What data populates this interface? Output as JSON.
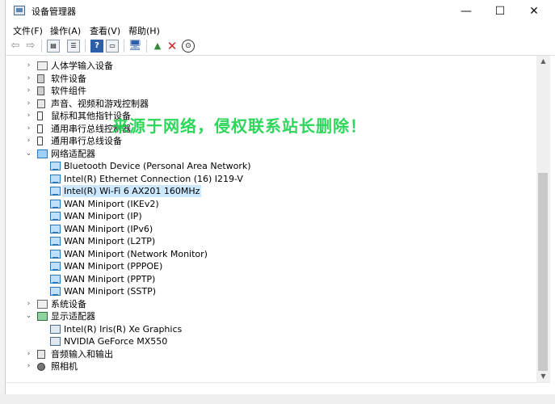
{
  "window": {
    "title": "设备管理器",
    "controls": {
      "minimize": "—",
      "maximize": "☐",
      "close": "✕"
    }
  },
  "menu": {
    "items": [
      {
        "label": "文件(F)"
      },
      {
        "label": "操作(A)"
      },
      {
        "label": "查看(V)"
      },
      {
        "label": "帮助(H)"
      }
    ]
  },
  "toolbar": {
    "buttons": [
      {
        "name": "back-arrow-icon",
        "glyph": "⇦"
      },
      {
        "name": "forward-arrow-icon",
        "glyph": "⇨"
      },
      {
        "name": "properties-icon",
        "glyph": "▤"
      },
      {
        "name": "view-list-icon",
        "glyph": "☰"
      },
      {
        "name": "help-icon",
        "glyph": "?"
      },
      {
        "name": "console-view-icon",
        "glyph": "▭"
      },
      {
        "name": "scan-hardware-icon",
        "glyph": "🖥"
      },
      {
        "name": "update-driver-icon",
        "glyph": "▲"
      },
      {
        "name": "uninstall-device-icon",
        "glyph": "✕"
      },
      {
        "name": "disable-device-icon",
        "glyph": "⊙"
      }
    ]
  },
  "tree": {
    "rows": [
      {
        "level": 0,
        "expander": "›",
        "icon": "ic-folder",
        "label": "人体学输入设备"
      },
      {
        "level": 0,
        "expander": "›",
        "icon": "ic-chip",
        "label": "软件设备"
      },
      {
        "level": 0,
        "expander": "›",
        "icon": "ic-chip",
        "label": "软件组件"
      },
      {
        "level": 0,
        "expander": "›",
        "icon": "ic-speaker",
        "label": "声音、视频和游戏控制器"
      },
      {
        "level": 0,
        "expander": "›",
        "icon": "ic-plug",
        "label": "鼠标和其他指针设备"
      },
      {
        "level": 0,
        "expander": "›",
        "icon": "ic-plug",
        "label": "通用串行总线控制器"
      },
      {
        "level": 0,
        "expander": "›",
        "icon": "ic-plug",
        "label": "通用串行总线设备"
      },
      {
        "level": 0,
        "expander": "⌄",
        "icon": "ic-adapter",
        "label": "网络适配器"
      },
      {
        "level": 1,
        "expander": "",
        "icon": "ic-net",
        "label": "Bluetooth Device (Personal Area Network)"
      },
      {
        "level": 1,
        "expander": "",
        "icon": "ic-net",
        "label": "Intel(R) Ethernet Connection (16) I219-V"
      },
      {
        "level": 1,
        "expander": "",
        "icon": "ic-net",
        "label": "Intel(R) Wi-Fi 6 AX201 160MHz",
        "selected": true
      },
      {
        "level": 1,
        "expander": "",
        "icon": "ic-net",
        "label": "WAN Miniport (IKEv2)"
      },
      {
        "level": 1,
        "expander": "",
        "icon": "ic-net",
        "label": "WAN Miniport (IP)"
      },
      {
        "level": 1,
        "expander": "",
        "icon": "ic-net",
        "label": "WAN Miniport (IPv6)"
      },
      {
        "level": 1,
        "expander": "",
        "icon": "ic-net",
        "label": "WAN Miniport (L2TP)"
      },
      {
        "level": 1,
        "expander": "",
        "icon": "ic-net",
        "label": "WAN Miniport (Network Monitor)"
      },
      {
        "level": 1,
        "expander": "",
        "icon": "ic-net",
        "label": "WAN Miniport (PPPOE)"
      },
      {
        "level": 1,
        "expander": "",
        "icon": "ic-net",
        "label": "WAN Miniport (PPTP)"
      },
      {
        "level": 1,
        "expander": "",
        "icon": "ic-net",
        "label": "WAN Miniport (SSTP)"
      },
      {
        "level": 0,
        "expander": "›",
        "icon": "ic-folder",
        "label": "系统设备"
      },
      {
        "level": 0,
        "expander": "⌄",
        "icon": "ic-display",
        "label": "显示适配器"
      },
      {
        "level": 1,
        "expander": "",
        "icon": "ic-monitor",
        "label": "Intel(R) Iris(R) Xe Graphics"
      },
      {
        "level": 1,
        "expander": "",
        "icon": "ic-monitor",
        "label": "NVIDIA GeForce MX550"
      },
      {
        "level": 0,
        "expander": "›",
        "icon": "ic-speaker",
        "label": "音频输入和输出"
      },
      {
        "level": 0,
        "expander": "›",
        "icon": "ic-camera",
        "label": "照相机"
      }
    ]
  },
  "watermark": "来源于网络，侵权联系站长删除！",
  "scrollbar": {
    "up": "▲",
    "down": "▼"
  }
}
